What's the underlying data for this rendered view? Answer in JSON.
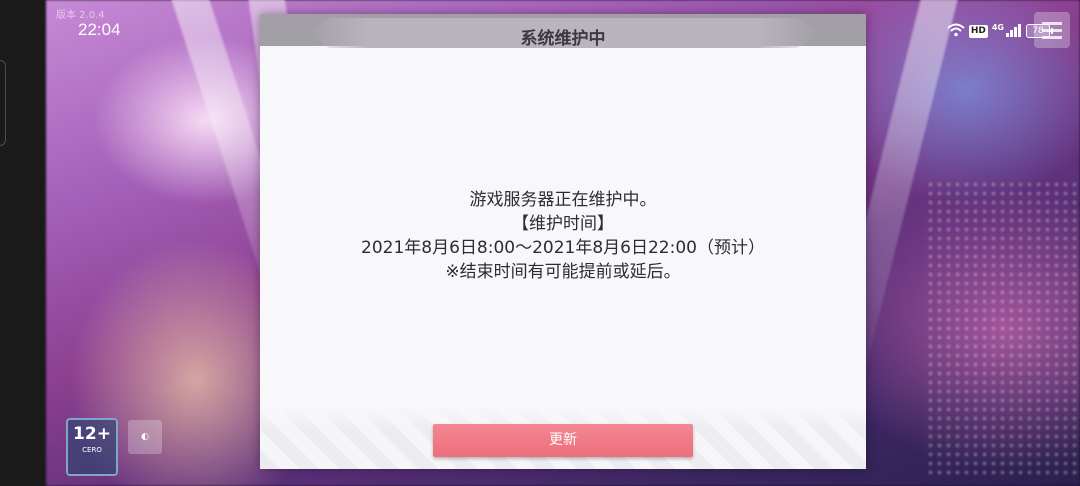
{
  "status_bar": {
    "time": "22:04",
    "network_label": "4G",
    "hd_label": "HD",
    "battery_level": "78"
  },
  "game": {
    "version_text": "版本 2.0.4",
    "age_rating": "12+",
    "age_rating_caption": "CERO"
  },
  "dialog": {
    "title": "系统维护中",
    "message_lines": [
      "游戏服务器正在维护中。",
      "【维护时间】",
      "2021年8月6日8:00～2021年8月6日22:00（预计）",
      "※结束时间有可能提前或延后。"
    ],
    "update_button_label": "更新"
  },
  "icons": {
    "wifi": "wifi-icon",
    "signal": "signal-icon",
    "battery": "battery-icon",
    "menu": "menu-icon"
  }
}
